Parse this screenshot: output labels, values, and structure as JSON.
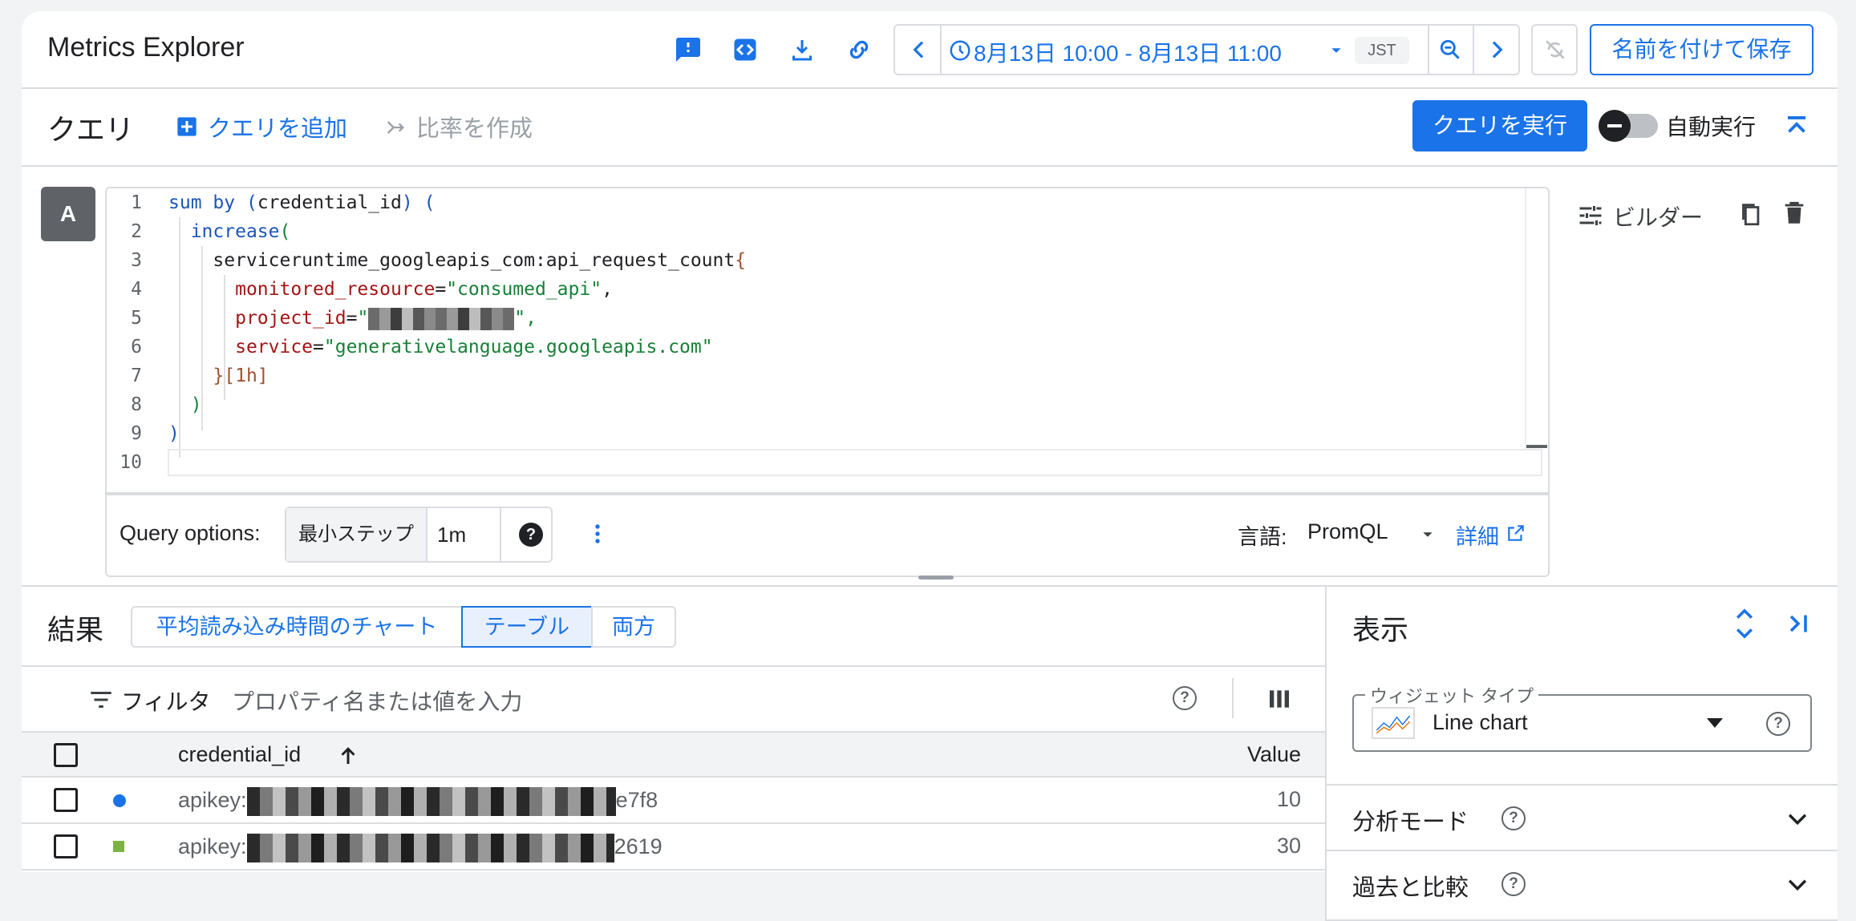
{
  "app": {
    "title": "Metrics Explorer"
  },
  "time": {
    "range": "8月13日 10:00 - 8月13日 11:00",
    "tz": "JST"
  },
  "toolbar": {
    "save_label": "名前を付けて保存"
  },
  "query_bar": {
    "title": "クエリ",
    "add_query": "クエリを追加",
    "create_ratio": "比率を作成",
    "run": "クエリを実行",
    "autorun": "自動実行"
  },
  "query": {
    "badge": "A",
    "builder": "ビルダー",
    "line_numbers": [
      "1",
      "2",
      "3",
      "4",
      "5",
      "6",
      "7",
      "8",
      "9",
      "10"
    ],
    "code": {
      "l1_sum": "sum",
      "l1_by": "by",
      "l1_open": "(",
      "l1_label": "credential_id",
      "l1_close": ")",
      "l1_paren": "(",
      "l2_fn": "increase",
      "l2_open": "(",
      "l3_metric": "serviceruntime_googleapis_com:api_request_count",
      "l3_brace": "{",
      "l4_label": "monitored_resource",
      "l4_value": "\"consumed_api\"",
      "l5_label": "project_id",
      "l5_quote_open": "\"",
      "l5_quote_close": "\",",
      "l6_label": "service",
      "l6_value": "\"generativelanguage.googleapis.com\"",
      "l7_close": "}",
      "l7_range": "[1h]",
      "l8_close": ")",
      "l9_close": ")",
      "eq": "=",
      "comma": ","
    }
  },
  "query_options": {
    "label": "Query options:",
    "min_step_label": "最小ステップ",
    "min_step_value": "1m",
    "language_label": "言語:",
    "language_value": "PromQL",
    "details": "詳細"
  },
  "results": {
    "title": "結果",
    "tabs": [
      "平均読み込み時間のチャート",
      "テーブル",
      "両方"
    ],
    "active_tab": "テーブル",
    "filter_label": "フィルタ",
    "filter_placeholder": "プロパティ名または値を入力",
    "columns": {
      "credential": "credential_id",
      "value": "Value"
    },
    "rows": [
      {
        "prefix": "apikey:",
        "suffix": "e7f8",
        "value": "10",
        "marker_color": "#1a73e8",
        "marker": "circle"
      },
      {
        "prefix": "apikey:",
        "suffix": "2619",
        "value": "30",
        "marker_color": "#7cb342",
        "marker": "square"
      }
    ]
  },
  "display_panel": {
    "title": "表示",
    "widget_type_label": "ウィジェット タイプ",
    "widget_type_value": "Line chart",
    "analysis_mode": "分析モード",
    "compare_past": "過去と比較"
  },
  "icons": {
    "toolbar": [
      "feedback-icon",
      "code-icon",
      "download-icon",
      "link-icon"
    ],
    "accent": "#1a73e8"
  }
}
